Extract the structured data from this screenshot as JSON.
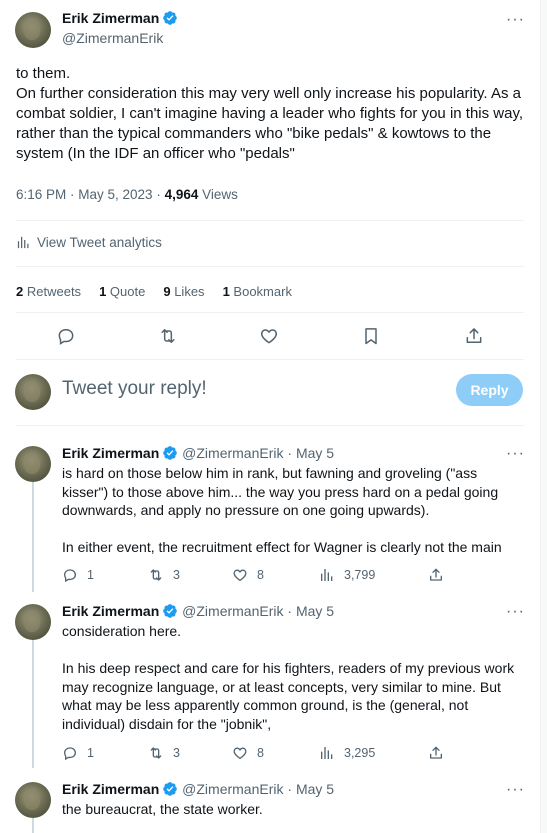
{
  "main_tweet": {
    "author_name": "Erik Zimerman",
    "author_handle": "@ZimermanErik",
    "text": "to them.\nOn further consideration this may very well only increase his popularity. As a combat soldier, I can't imagine having a leader who fights for you in this way, rather than the typical commanders who \"bike pedals\" & kowtows to the system (In the IDF an officer who \"pedals\"",
    "timestamp": "6:16 PM · May 5, 2023",
    "separator": " · ",
    "views_count": "4,964",
    "views_label": " Views",
    "analytics_label": "View Tweet analytics",
    "stats": {
      "retweets_count": "2",
      "retweets_label": "Retweets",
      "quotes_count": "1",
      "quotes_label": "Quote",
      "likes_count": "9",
      "likes_label": "Likes",
      "bookmarks_count": "1",
      "bookmarks_label": "Bookmark"
    }
  },
  "composer": {
    "placeholder": "Tweet your reply!",
    "button_label": "Reply"
  },
  "replies": [
    {
      "author_name": "Erik Zimerman",
      "author_handle": "@ZimermanErik",
      "date": "· May 5",
      "text": "is hard on those below him in rank, but fawning and groveling (\"ass kisser\") to those above him... the way you press hard on a pedal going downwards, and apply no pressure on one going upwards).\n\nIn either event, the recruitment effect for Wagner is clearly not the main",
      "replies": "1",
      "retweets": "3",
      "likes": "8",
      "views": "3,799"
    },
    {
      "author_name": "Erik Zimerman",
      "author_handle": "@ZimermanErik",
      "date": "· May 5",
      "text": "consideration here.\n\nIn his deep respect and care for his fighters, readers of my previous work may recognize language, or at least concepts, very similar to mine. But what may be less apparently common ground, is the (general, not individual) disdain for the \"jobnik\",",
      "replies": "1",
      "retweets": "3",
      "likes": "8",
      "views": "3,295"
    },
    {
      "author_name": "Erik Zimerman",
      "author_handle": "@ZimermanErik",
      "date": "· May 5",
      "text": "the bureaucrat, the state worker."
    }
  ],
  "icons": {
    "more": "more-icon",
    "verified": "verified-badge-icon",
    "analytics": "bar-chart-icon",
    "reply": "reply-icon",
    "retweet": "retweet-icon",
    "like": "heart-icon",
    "bookmark": "bookmark-icon",
    "share": "share-icon",
    "views": "views-icon"
  },
  "colors": {
    "text": "#0f1419",
    "muted": "#536471",
    "verified": "#1d9bf0",
    "reply_button_disabled": "#8ecdf8",
    "divider": "#eff3f4",
    "thread_line": "#cfd9de"
  }
}
